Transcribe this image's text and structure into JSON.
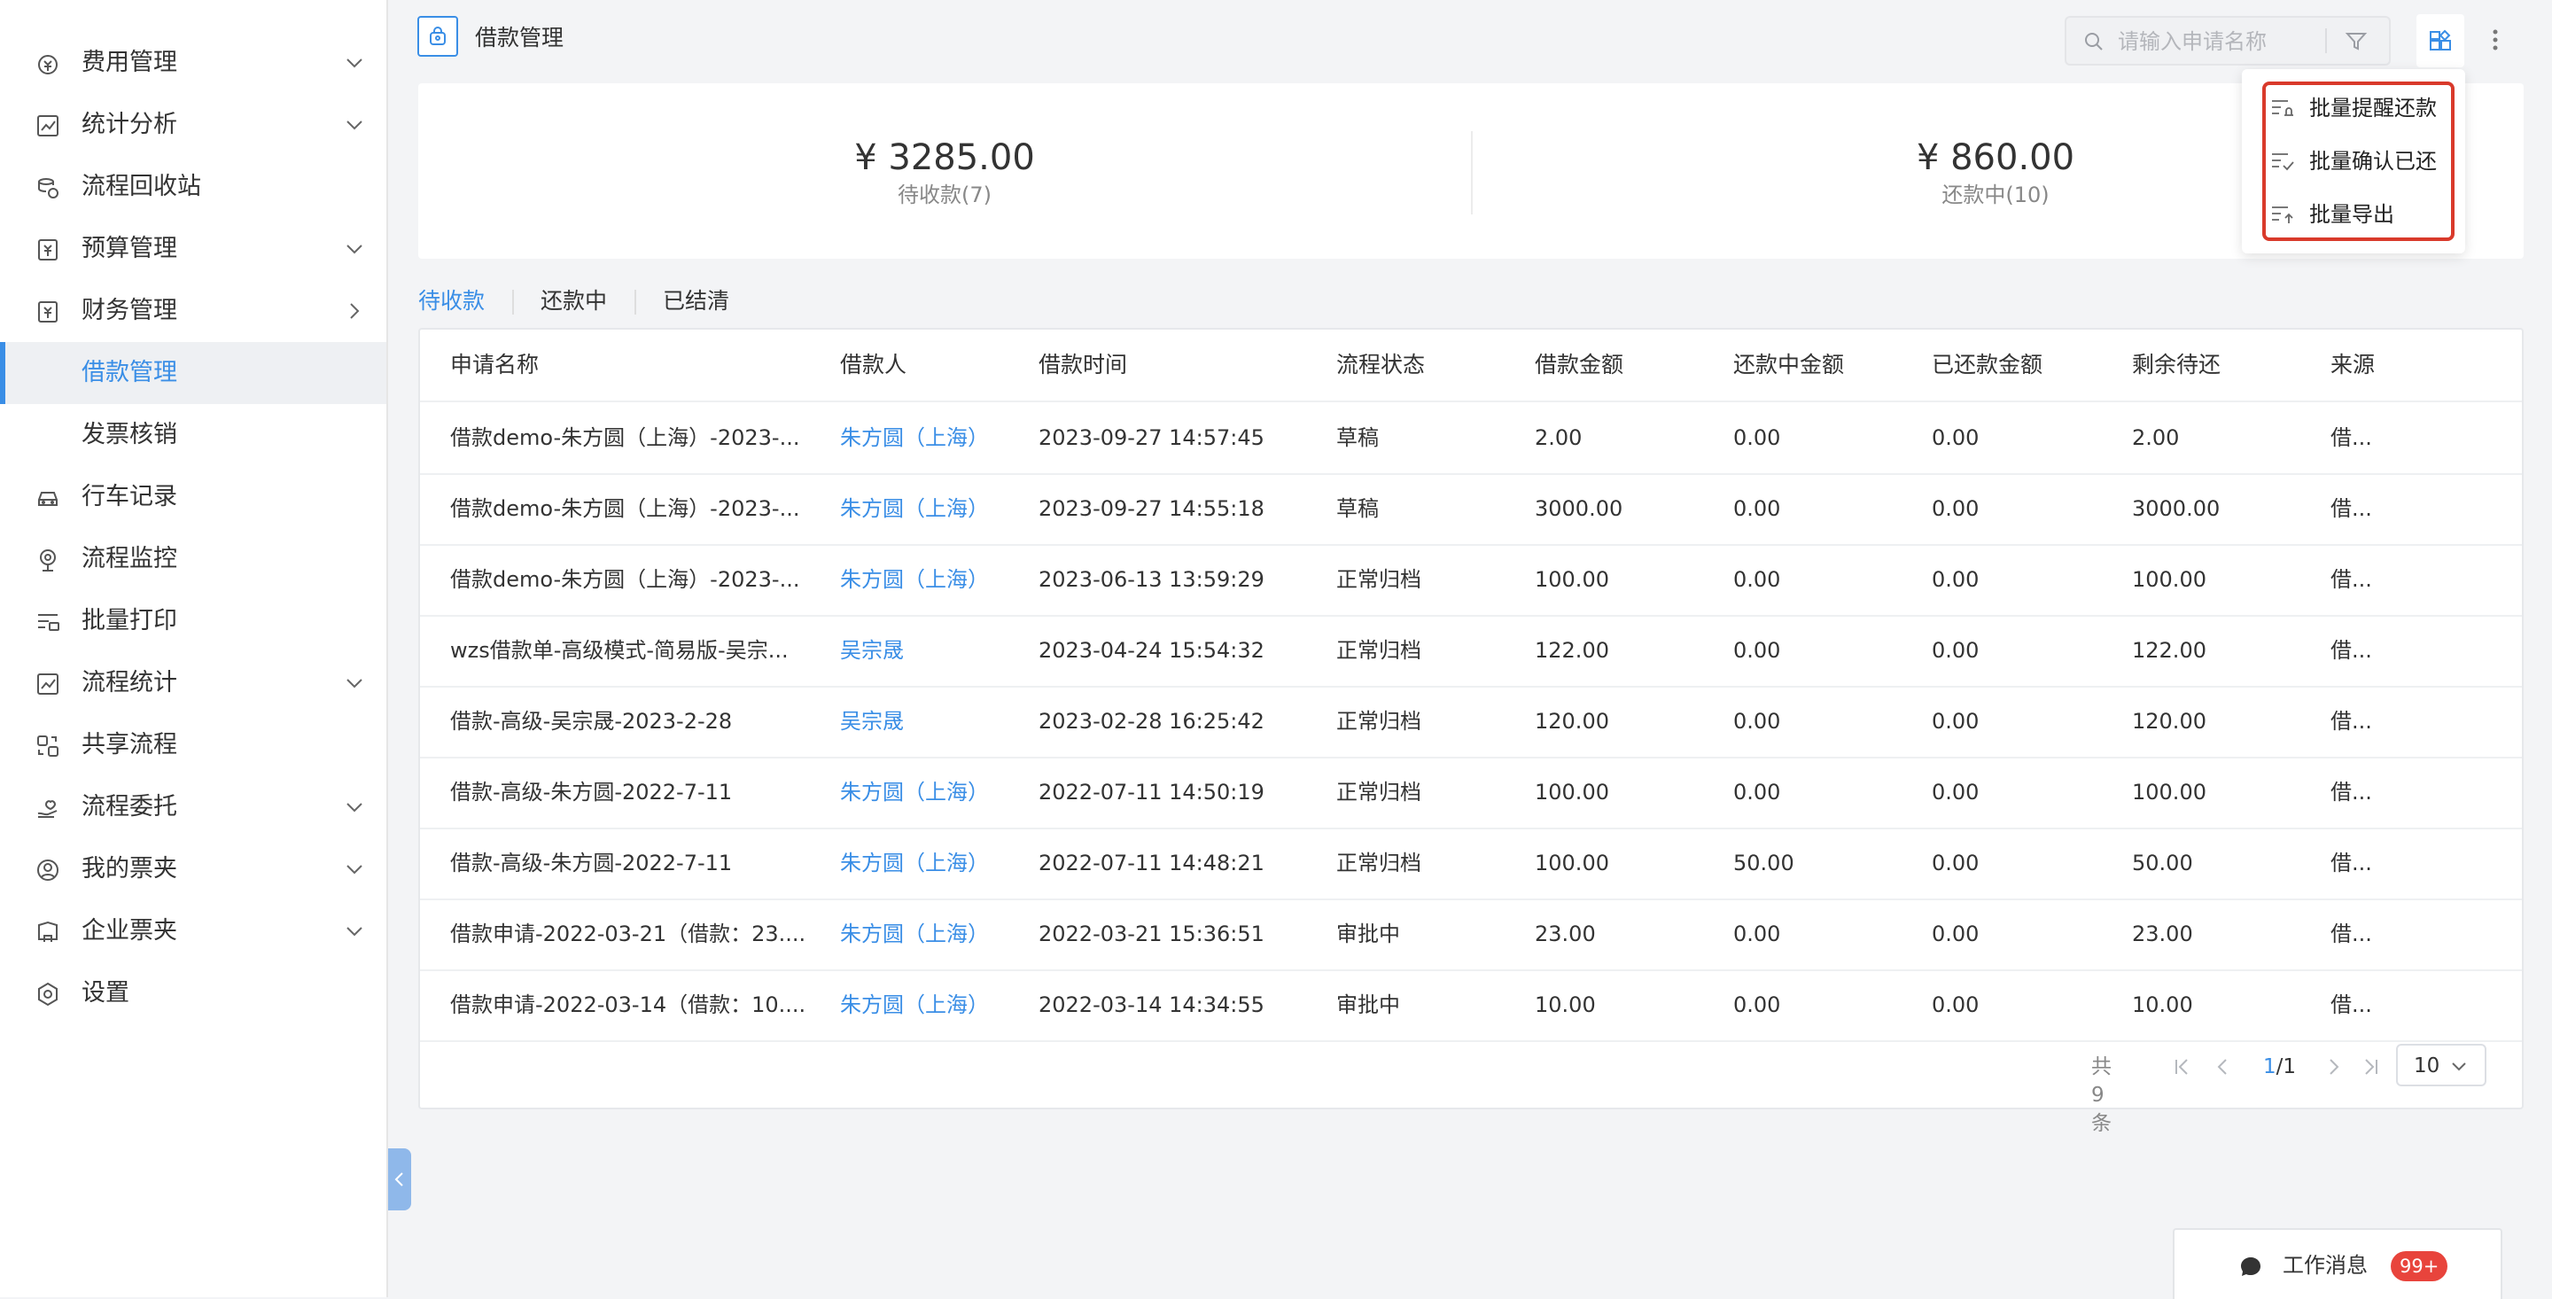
{
  "sidebar": {
    "items": [
      {
        "label": "费用管理",
        "icon": "expense-icon",
        "chevron": "down"
      },
      {
        "label": "统计分析",
        "icon": "chart-icon",
        "chevron": "down"
      },
      {
        "label": "流程回收站",
        "icon": "recycle-icon",
        "chevron": ""
      },
      {
        "label": "预算管理",
        "icon": "budget-icon",
        "chevron": "down"
      },
      {
        "label": "财务管理",
        "icon": "finance-icon",
        "chevron": "right"
      },
      {
        "label": "借款管理",
        "icon": "",
        "chevron": "",
        "active": true
      },
      {
        "label": "发票核销",
        "icon": "",
        "chevron": ""
      },
      {
        "label": "行车记录",
        "icon": "car-icon",
        "chevron": ""
      },
      {
        "label": "流程监控",
        "icon": "monitor-icon",
        "chevron": ""
      },
      {
        "label": "批量打印",
        "icon": "print-icon",
        "chevron": ""
      },
      {
        "label": "流程统计",
        "icon": "stats-icon",
        "chevron": "down"
      },
      {
        "label": "共享流程",
        "icon": "share-icon",
        "chevron": ""
      },
      {
        "label": "流程委托",
        "icon": "delegate-icon",
        "chevron": "down"
      },
      {
        "label": "我的票夹",
        "icon": "my-ticket-icon",
        "chevron": "down"
      },
      {
        "label": "企业票夹",
        "icon": "company-ticket-icon",
        "chevron": "down"
      },
      {
        "label": "设置",
        "icon": "settings-icon",
        "chevron": ""
      }
    ]
  },
  "header": {
    "title": "借款管理",
    "search_placeholder": "请输入申请名称"
  },
  "summary": [
    {
      "amount": "¥ 3285.00",
      "label": "待收款(7)"
    },
    {
      "amount": "¥ 860.00",
      "label": "还款中(10)"
    }
  ],
  "tabs": [
    "待收款",
    "还款中",
    "已结清"
  ],
  "table": {
    "columns": [
      "申请名称",
      "借款人",
      "借款时间",
      "流程状态",
      "借款金额",
      "还款中金额",
      "已还款金额",
      "剩余待还",
      "来源"
    ],
    "rows": [
      [
        "借款demo-朱方圆（上海）-2023-...",
        "朱方圆（上海）",
        "2023-09-27 14:57:45",
        "草稿",
        "2.00",
        "0.00",
        "0.00",
        "2.00",
        "借..."
      ],
      [
        "借款demo-朱方圆（上海）-2023-...",
        "朱方圆（上海）",
        "2023-09-27 14:55:18",
        "草稿",
        "3000.00",
        "0.00",
        "0.00",
        "3000.00",
        "借..."
      ],
      [
        "借款demo-朱方圆（上海）-2023-...",
        "朱方圆（上海）",
        "2023-06-13 13:59:29",
        "正常归档",
        "100.00",
        "0.00",
        "0.00",
        "100.00",
        "借..."
      ],
      [
        "wzs借款单-高级模式-简易版-吴宗...",
        "吴宗晟",
        "2023-04-24 15:54:32",
        "正常归档",
        "122.00",
        "0.00",
        "0.00",
        "122.00",
        "借..."
      ],
      [
        "借款-高级-吴宗晟-2023-2-28",
        "吴宗晟",
        "2023-02-28 16:25:42",
        "正常归档",
        "120.00",
        "0.00",
        "0.00",
        "120.00",
        "借..."
      ],
      [
        "借款-高级-朱方圆-2022-7-11",
        "朱方圆（上海）",
        "2022-07-11 14:50:19",
        "正常归档",
        "100.00",
        "0.00",
        "0.00",
        "100.00",
        "借..."
      ],
      [
        "借款-高级-朱方圆-2022-7-11",
        "朱方圆（上海）",
        "2022-07-11 14:48:21",
        "正常归档",
        "100.00",
        "50.00",
        "0.00",
        "50.00",
        "借..."
      ],
      [
        "借款申请-2022-03-21（借款：23....",
        "朱方圆（上海）",
        "2022-03-21 15:36:51",
        "审批中",
        "23.00",
        "0.00",
        "0.00",
        "23.00",
        "借..."
      ],
      [
        "借款申请-2022-03-14（借款：10....",
        "朱方圆（上海）",
        "2022-03-14 14:34:55",
        "审批中",
        "10.00",
        "0.00",
        "0.00",
        "10.00",
        "借..."
      ]
    ]
  },
  "pagination": {
    "total": "共9条",
    "current": "1",
    "pages": "/1",
    "page_size": "10"
  },
  "dropdown": {
    "items": [
      {
        "label": "批量提醒还款",
        "icon": "remind-icon"
      },
      {
        "label": "批量确认已还",
        "icon": "confirm-icon"
      },
      {
        "label": "批量导出",
        "icon": "export-icon"
      }
    ]
  },
  "messages": {
    "label": "工作消息",
    "badge": "99+"
  },
  "colors": {
    "accent": "#3a8ee6",
    "highlight": "#d93a2b",
    "badge": "#e8443c"
  }
}
